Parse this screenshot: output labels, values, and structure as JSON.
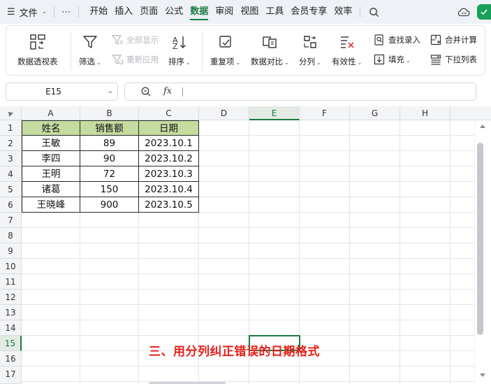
{
  "menubar": {
    "file_label": "文件",
    "more_label": "⋯",
    "tabs": [
      "开始",
      "插入",
      "页面",
      "公式",
      "数据",
      "审阅",
      "视图",
      "工具",
      "会员专享",
      "效率"
    ],
    "active_tab": "数据",
    "accent_color": "#1a7c3f"
  },
  "ribbon": {
    "pivot": "数据透视表",
    "filter": "筛选",
    "show_all": "全部显示",
    "reapply": "重新应用",
    "sort": "排序",
    "duplicates": "重复项",
    "compare": "数据对比",
    "split": "分列",
    "validity": "有效性",
    "lookup": "查找录入",
    "fill": "填充",
    "merge_calc": "合并计算",
    "dropdown_list": "下拉列表"
  },
  "formula_bar": {
    "name_box": "E15",
    "fx": "fx",
    "value": ""
  },
  "grid": {
    "columns": [
      "A",
      "B",
      "C",
      "D",
      "E",
      "F",
      "G",
      "H"
    ],
    "rows": [
      "1",
      "2",
      "3",
      "4",
      "5",
      "6",
      "7",
      "8",
      "9",
      "10",
      "11",
      "12",
      "13",
      "14",
      "15",
      "16",
      "17"
    ],
    "selected_column": "E",
    "selected_row": "15",
    "table": {
      "headers": [
        "姓名",
        "销售额",
        "日期"
      ],
      "rows": [
        [
          "王敏",
          "89",
          "2023.10.1"
        ],
        [
          "李四",
          "90",
          "2023.10.2"
        ],
        [
          "王明",
          "72",
          "2023.10.3"
        ],
        [
          "诸葛",
          "150",
          "2023.10.4"
        ],
        [
          "王晓峰",
          "900",
          "2023.10.5"
        ]
      ],
      "header_fill": "#c5dba0"
    }
  },
  "caption": "三、用分列纠正错误的日期格式",
  "caption_color": "#e8201a"
}
